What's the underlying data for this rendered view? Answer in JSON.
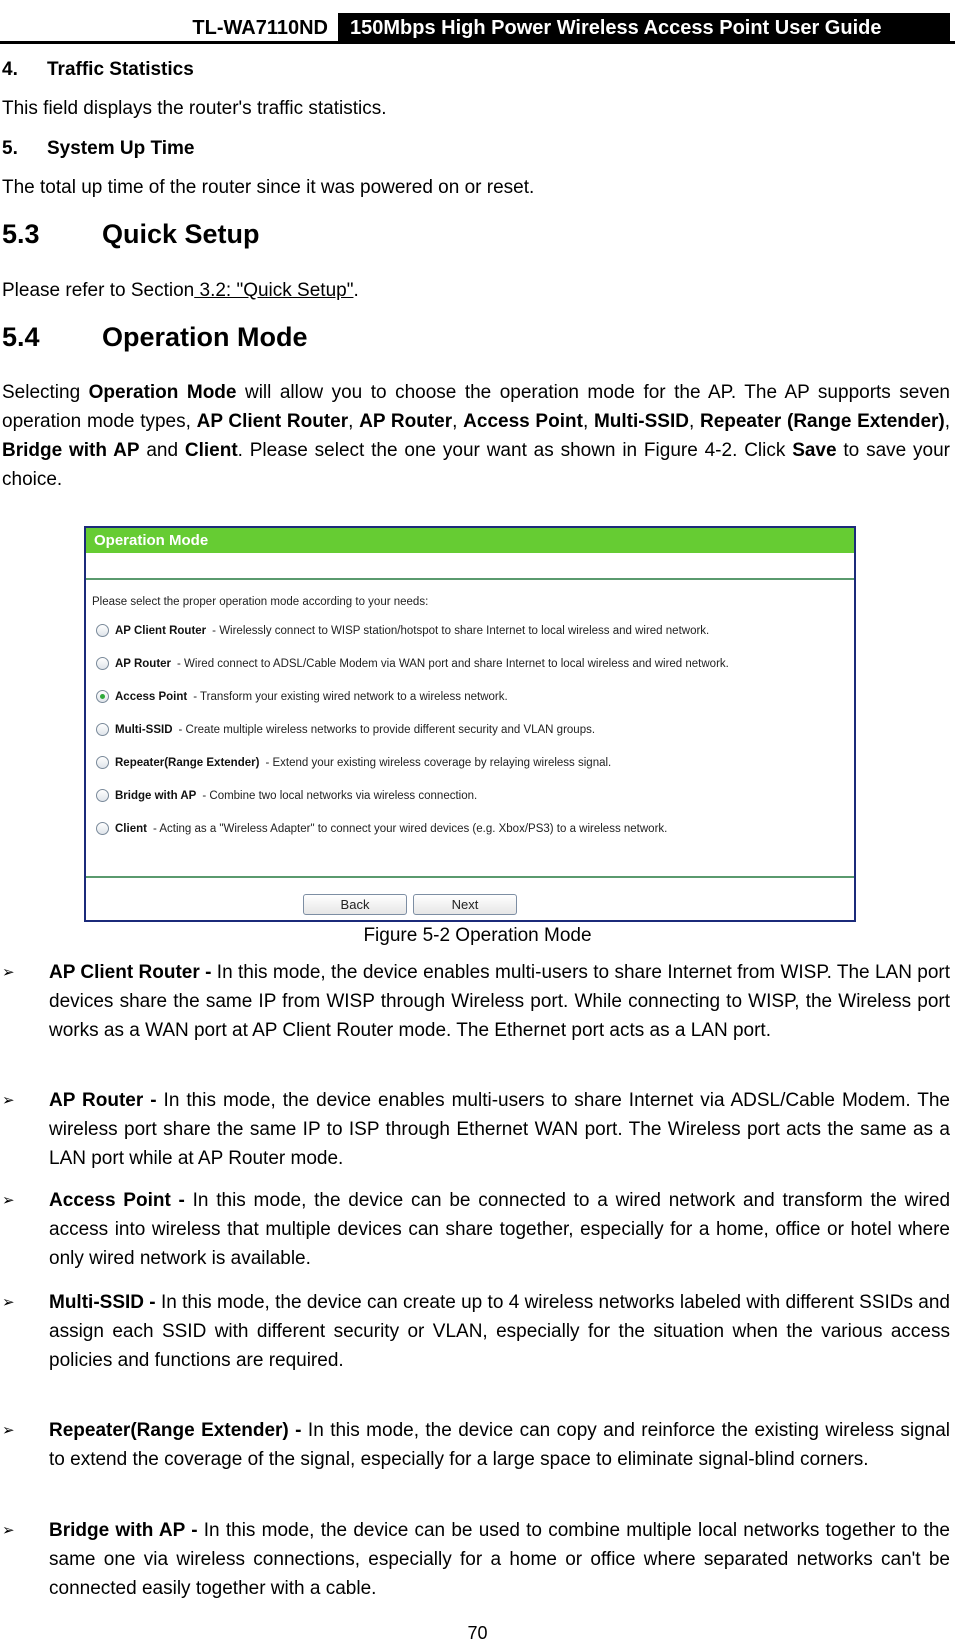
{
  "header": {
    "model": "TL-WA7110ND",
    "guide_title": "150Mbps High Power Wireless Access Point User Guide"
  },
  "items": {
    "traffic": {
      "num": "4.",
      "title": "Traffic Statistics",
      "text": "This field displays the router's traffic statistics."
    },
    "uptime": {
      "num": "5.",
      "title": "System Up Time",
      "text": "The total up time of the router since it was powered on or reset."
    }
  },
  "sections": {
    "quick_setup": {
      "num": "5.3",
      "title": "Quick Setup",
      "text_prefix": "Please refer to Section",
      "link": " 3.2: \"Quick Setup\"",
      "text_suffix": "."
    },
    "operation_mode": {
      "num": "5.4",
      "title": "Operation Mode",
      "intro": [
        {
          "t": "Selecting ",
          "b": false
        },
        {
          "t": "Operation Mode",
          "b": true
        },
        {
          "t": " will allow you to choose the operation mode for the AP.   The  AP supports seven operation mode types, ",
          "b": false
        },
        {
          "t": "AP Client Router",
          "b": true
        },
        {
          "t": ", ",
          "b": false
        },
        {
          "t": "AP Router",
          "b": true
        },
        {
          "t": ", ",
          "b": false
        },
        {
          "t": "Access Point",
          "b": true
        },
        {
          "t": ", ",
          "b": false
        },
        {
          "t": "Multi-SSID",
          "b": true
        },
        {
          "t": ", ",
          "b": false
        },
        {
          "t": "Repeater (Range Extender)",
          "b": true
        },
        {
          "t": ", ",
          "b": false
        },
        {
          "t": "Bridge with AP",
          "b": true
        },
        {
          "t": " and ",
          "b": false
        },
        {
          "t": "Client",
          "b": true
        },
        {
          "t": ". Please select the one your want as shown in Figure 4-2. Click ",
          "b": false
        },
        {
          "t": "Save",
          "b": true
        },
        {
          "t": " to save your choice.",
          "b": false
        }
      ]
    }
  },
  "figure": {
    "panel_title": "Operation Mode",
    "prompt": "Please select the proper operation mode according to your needs:",
    "selected_index": 2,
    "options": [
      {
        "name": "AP Client Router",
        "desc": "- Wirelessly connect to WISP station/hotspot to share Internet to local wireless and wired network."
      },
      {
        "name": "AP Router",
        "desc": "- Wired connect to ADSL/Cable Modem via WAN port and share Internet to local wireless and wired network."
      },
      {
        "name": "Access Point",
        "desc": "- Transform your existing wired network to a wireless network."
      },
      {
        "name": "Multi-SSID",
        "desc": "- Create multiple wireless networks to provide different security and VLAN groups."
      },
      {
        "name": "Repeater(Range Extender)",
        "desc": "- Extend your existing wireless coverage by relaying wireless signal."
      },
      {
        "name": "Bridge with AP",
        "desc": "- Combine two local networks via wireless connection."
      },
      {
        "name": "Client",
        "desc": "- Acting as a \"Wireless Adapter\" to connect your wired devices (e.g. Xbox/PS3) to a wireless network."
      }
    ],
    "back_label": "Back",
    "next_label": "Next",
    "caption": "Figure 5-2 Operation Mode",
    "colors": {
      "header_bg": "#66cc33",
      "border": "#1b2a7a",
      "rule": "#5a9a6e",
      "radio_selected": "#2faa3a"
    }
  },
  "bullets": [
    {
      "name": "AP Client Router -",
      "text": " In this mode, the device enables multi-users to share Internet from WISP. The LAN port devices share the same IP from WISP through Wireless port. While connecting to WISP, the Wireless port works as a WAN port at AP Client Router mode. The Ethernet port acts as a LAN port."
    },
    {
      "name": "AP Router -",
      "text": " In this mode, the device enables multi-users to share Internet via ADSL/Cable Modem. The wireless port share the same IP to ISP through Ethernet WAN port.   The Wireless port acts the same as a LAN port while at AP Router mode."
    },
    {
      "name": "Access Point -",
      "text": " In this mode, the device can be connected to a wired network and transform the wired access into wireless that multiple devices can share together, especially   for   a home, office or hotel where only wired network is available."
    },
    {
      "name": "Multi-SSID  -",
      "text": " In this mode, the device can create up to 4 wireless networks labeled  with different SSIDs and assign each SSID with different security or VLAN,  especially  for  the situation when the various access policies and functions are required."
    },
    {
      "name": "Repeater(Range Extender) -",
      "text": " In this mode, the device can copy and reinforce the existing wireless signal to extend the coverage of the signal, especially for a large space to eliminate signal-blind corners."
    },
    {
      "name": "Bridge with AP -",
      "text": " In this mode, the device can be used to combine multiple local networks together to the same one via wireless connections, especially for a home or office where separated networks can't be connected easily together with a cable."
    }
  ],
  "bullet_marker": "➢",
  "page_number": "70"
}
